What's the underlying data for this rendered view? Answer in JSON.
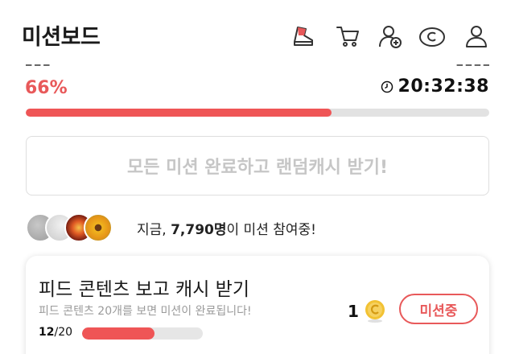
{
  "header": {
    "title": "미션보드",
    "icons": [
      "mission-shoe-icon",
      "cart-icon",
      "add-friend-icon",
      "coin-c-icon",
      "user-icon"
    ]
  },
  "progress": {
    "percent_text": "66%",
    "fraction": 0.66,
    "timer_text": "20:32:38",
    "bar_color": "#ef5556"
  },
  "all_missions_button": {
    "label": "모든 미션 완료하고 랜덤캐시 받기!"
  },
  "participants": {
    "prefix": "지금, ",
    "count": "7,790명",
    "suffix": "이 미션 참여중!"
  },
  "mission_card": {
    "title": "피드 콘텐츠 보고 캐시 받기",
    "subtitle": "피드 콘텐츠 20개를 보면 미션이 완료됩니다!",
    "current": "12",
    "total": "/20",
    "progress_fraction": 0.6,
    "reward": "1",
    "button_label": "미션중"
  },
  "colors": {
    "accent": "#e8595a",
    "coin": "#f2c233"
  }
}
